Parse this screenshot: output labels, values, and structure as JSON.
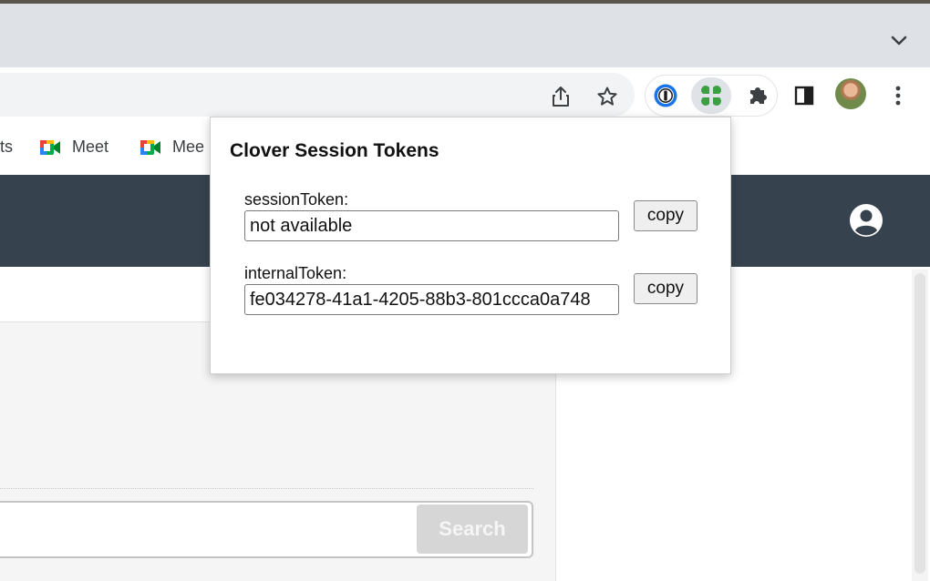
{
  "browser": {
    "bookmarks": [
      {
        "label": "ts"
      },
      {
        "label": "Meet"
      },
      {
        "label": "Mee"
      }
    ]
  },
  "popup": {
    "title": "Clover Session Tokens",
    "fields": [
      {
        "label": "sessionToken:",
        "value": "not available",
        "button": "copy"
      },
      {
        "label": "internalToken:",
        "value": "fe034278-41a1-4205-88b3-801ccca0a748",
        "button": "copy"
      }
    ]
  },
  "page": {
    "search_button": "Search"
  },
  "colors": {
    "header_bg": "#36434e",
    "tabstrip_bg": "#dee1e6",
    "clover_green": "#3aa042",
    "onepassword_blue": "#1a73e8"
  },
  "icons": [
    "chevron-down-icon",
    "share-icon",
    "star-icon",
    "onepassword-icon",
    "clover-icon",
    "puzzle-icon",
    "side-panel-icon",
    "avatar",
    "kebab-menu-icon",
    "meet-icon",
    "account-circle-icon"
  ]
}
